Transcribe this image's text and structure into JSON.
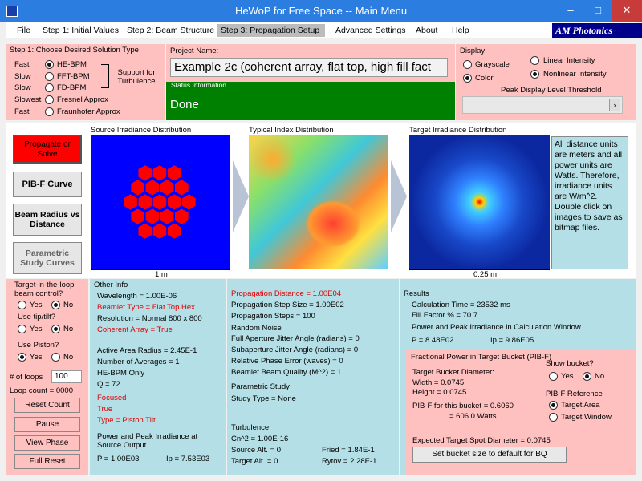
{
  "window": {
    "title": "HeWoP for Free Space -- Main Menu",
    "minimize": "–",
    "maximize": "□",
    "close": "✕"
  },
  "menu": [
    "File",
    "Step 1: Initial Values",
    "Step 2: Beam Structure",
    "Step 3: Propagation Setup",
    "Advanced Settings",
    "About",
    "Help"
  ],
  "logo": "AM Photonics",
  "step1": {
    "title": "Step 1: Choose Desired Solution Type",
    "speeds": [
      "Fast",
      "Slow",
      "Slow",
      "Slowest",
      "Fast"
    ],
    "options": [
      "HE-BPM",
      "FFT-BPM",
      "FD-BPM",
      "Fresnel Approx",
      "Fraunhofer Approx"
    ],
    "support": "Support for Turbulence"
  },
  "project": {
    "label": "Project Name:",
    "value": "Example 2c (coherent array, flat top, high fill fact"
  },
  "status": {
    "label": "Status Information",
    "value": "Done"
  },
  "display": {
    "label": "Display",
    "grayscale": "Grayscale",
    "color": "Color",
    "linear": "Linear Intensity",
    "nonlinear": "Nonlinear Intensity",
    "threshold": "Peak Display Level Threshold"
  },
  "buttons": {
    "propagate": "Propagate or Solve",
    "pibf": "PIB-F Curve",
    "beamradius": "Beam Radius vs Distance",
    "parametric": "Parametric Study Curves"
  },
  "images": {
    "source": "Source Irradiance Distribution",
    "index": "Typical Index Distribution",
    "target": "Target Irradiance Distribution",
    "source_scale": "1 m",
    "target_scale": "0.25 m"
  },
  "note": "All distance units are meters and all power units are Watts.  Therefore, irradiance units are W/m^2.  Double click on images to save as bitmap files.",
  "loop": {
    "target_loop": "Target-in-the-loop beam control?",
    "tiptilt": "Use tip/tilt?",
    "piston": "Use Piston?",
    "yes": "Yes",
    "no": "No",
    "num_loops_label": "# of loops",
    "num_loops": "100",
    "count": "Loop count =  0000",
    "reset_count": "Reset Count",
    "pause": "Pause",
    "view_phase": "View Phase",
    "full_reset": "Full Reset"
  },
  "other": {
    "title": "Other Info",
    "wavelength": "Wavelength =  1.00E-06",
    "beamlet_type": "Beamlet Type =  Flat Top Hex",
    "resolution": "Resolution =  Normal     800 x 800",
    "coherent": "Coherent Array =  True",
    "active_radius": "Active Area Radius =  2.45E-1",
    "averages": "Number of Averages =  1",
    "hebpm": "HE-BPM Only",
    "q": "Q = 72",
    "focused": "Focused",
    "true": "True",
    "type": "Type =  Piston Tilt",
    "power_title": "Power and Peak Irradiance at Source Output",
    "p": "P =  1.00E03",
    "ip": "Ip =  7.53E03"
  },
  "prop": {
    "distance": "Propagation Distance =  1.00E04",
    "stepsize": "Propagation Step Size =  1.00E02",
    "steps": "Propagation Steps = 100",
    "noise_title": "Random Noise",
    "full_jitter": "Full Aperture Jitter Angle (radians) =  0",
    "sub_jitter": "Subaperture Jitter Angle (radians) =  0",
    "phase_err": "Relative Phase Error (waves) =   0",
    "bq": "Beamlet Beam Quality (M^2) =   1",
    "param_title": "Parametric Study",
    "study": "Study Type =   None",
    "turb_title": "Turbulence",
    "cn2": "Cn^2 = 1.00E-16",
    "src_alt": "Source Alt. =    0",
    "tgt_alt": "Target Alt. =    0",
    "fried": "Fried =    1.84E-1",
    "rytov": "Rytov =    2.28E-1"
  },
  "results": {
    "title": "Results",
    "calc_time": "Calculation Time =   23532 ms",
    "fill": "Fill Factor % =   70.7",
    "pp_title": "Power and Peak Irradiance in Calculation Window",
    "p": "P =  8.48E02",
    "ip": "Ip =  9.86E05",
    "pibf_title": "Fractional Power in Target Bucket (PIB-F)",
    "diam": "Target Bucket Diameter:",
    "width": "Width =    0.0745",
    "height": "Height =   0.0745",
    "pib": "PIB-F for this bucket =  0.6060",
    "watts": "=    606.0 Watts",
    "show": "Show bucket?",
    "yes": "Yes",
    "no": "No",
    "ref": "PIB-F Reference",
    "area": "Target Area",
    "window": "Target Window",
    "spot": "Expected Target Spot Diameter  =   0.0745",
    "setbtn": "Set bucket size to default for BQ"
  },
  "colors": {
    "titlebar": "#2b7de0",
    "pink": "#ffc0c0",
    "cyan": "#b4dfe6",
    "status": "#008000",
    "propagate": "#ff0000",
    "source_bg": "#0000ff",
    "hex": "#ff0000"
  }
}
